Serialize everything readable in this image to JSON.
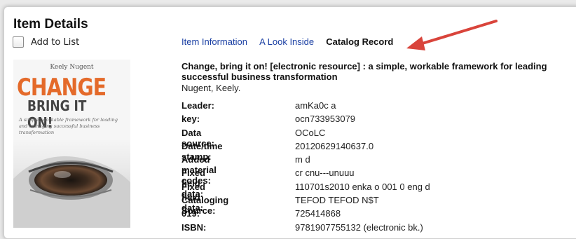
{
  "page": {
    "title": "Item Details"
  },
  "add_to_list": {
    "label": "Add to List",
    "checked": false
  },
  "book_cover": {
    "author": "Keely Nugent",
    "title_line1": "CHANGE",
    "title_line2": "BRING IT ON!",
    "subtitle": "A simple, workable framework for leading and managing successful business transformation",
    "accent_color": "#e46a2a"
  },
  "tabs": [
    {
      "label": "Item Information",
      "active": false
    },
    {
      "label": "A Look Inside",
      "active": false
    },
    {
      "label": "Catalog Record",
      "active": true
    }
  ],
  "record": {
    "title_line1": "Change, bring it on! [electronic resource] : a simple, workable framework for leading",
    "title_line2": "successful business transformation",
    "author": "Nugent, Keely."
  },
  "fields": [
    {
      "label": "Leader:",
      "value": "amKa0c a"
    },
    {
      "label": "key:",
      "value": "ocn733953079"
    },
    {
      "label": "Data source:",
      "value": "OCoLC"
    },
    {
      "label": "Date/time stamp:",
      "value": "20120629140637.0"
    },
    {
      "label": "Added material codes:",
      "value": "m d"
    },
    {
      "label": "Fixed field data:",
      "value": "cr cnu---unuuu"
    },
    {
      "label": "Fixed field data:",
      "value": "110701s2010 enka o 001 0 eng d"
    },
    {
      "label": "Cataloging Source:",
      "value": "TEFOD TEFOD N$T"
    },
    {
      "label": "019:",
      "value": "725414868"
    },
    {
      "label": "ISBN:",
      "value": "9781907755132 (electronic bk.)"
    }
  ],
  "annotation": {
    "arrow_color": "#d9443b"
  }
}
